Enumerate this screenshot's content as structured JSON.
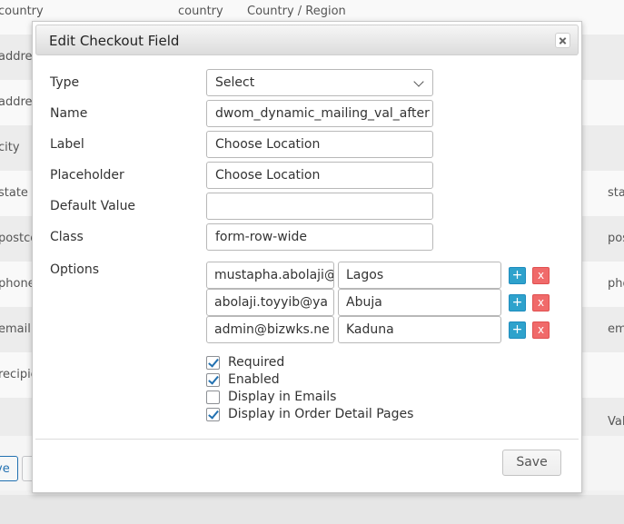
{
  "background": {
    "rows": [
      {
        "c1": "country",
        "c2": "country",
        "c3": "Country / Region",
        "c4": ""
      },
      {
        "c1": "address",
        "c2": "",
        "c3": "",
        "c4": ""
      },
      {
        "c1": "address",
        "c2": "",
        "c3": "",
        "c4": ""
      },
      {
        "c1": "city",
        "c2": "",
        "c3": "",
        "c4": ""
      },
      {
        "c1": "state",
        "c2": "",
        "c3": "",
        "c4": "sta"
      },
      {
        "c1": "postcode",
        "c2": "",
        "c3": "",
        "c4": "pos"
      },
      {
        "c1": "phone",
        "c2": "",
        "c3": "",
        "c4": "pho"
      },
      {
        "c1": "email",
        "c2": "",
        "c3": "",
        "c4": "em"
      },
      {
        "c1": "recipient",
        "c2": "",
        "c3": "",
        "c4": ""
      },
      {
        "c1": "",
        "c2": "",
        "c3": "",
        "c4": "Val"
      }
    ],
    "buttons": [
      "ve",
      ""
    ]
  },
  "modal": {
    "title": "Edit Checkout Field",
    "close_icon": "close-icon",
    "fields": {
      "type": {
        "label": "Type",
        "value": "Select"
      },
      "name": {
        "label": "Name",
        "value": "dwom_dynamic_mailing_val_after"
      },
      "label": {
        "label": "Label",
        "value": "Choose Location"
      },
      "placeholder": {
        "label": "Placeholder",
        "value": "Choose Location"
      },
      "default_value": {
        "label": "Default Value",
        "value": ""
      },
      "class": {
        "label": "Class",
        "value": "form-row-wide"
      }
    },
    "options_label": "Options",
    "options": [
      {
        "key": "mustapha.abolaji@",
        "value": "Lagos"
      },
      {
        "key": "abolaji.toyyib@ya",
        "value": "Abuja"
      },
      {
        "key": "admin@bizwks.ne",
        "value": "Kaduna"
      }
    ],
    "option_add_label": "+",
    "option_remove_label": "x",
    "checkboxes": [
      {
        "label": "Required",
        "checked": true
      },
      {
        "label": "Enabled",
        "checked": true
      },
      {
        "label": "Display in Emails",
        "checked": false
      },
      {
        "label": "Display in Order Detail Pages",
        "checked": true
      }
    ],
    "save_label": "Save"
  },
  "colors": {
    "add_button": "#2ea2cc",
    "remove_button": "#f06a6a",
    "checkmark": "#2271b1"
  }
}
